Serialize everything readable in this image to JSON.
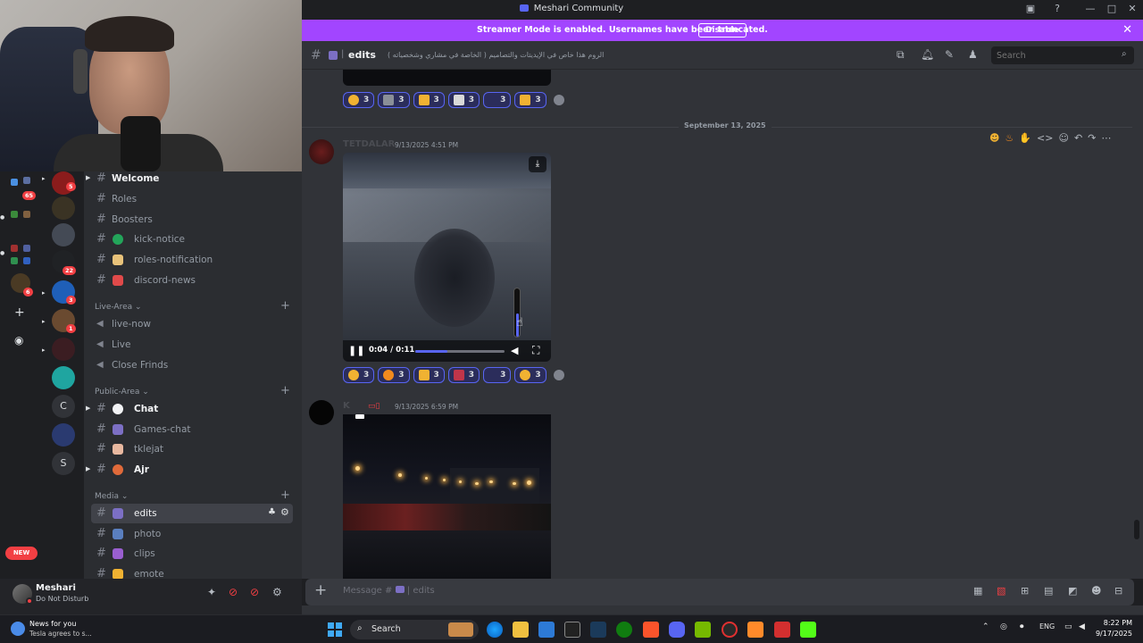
{
  "window": {
    "title": "Meshari Community"
  },
  "banner": {
    "message": "Streamer Mode is enabled. Usernames have been truncated.",
    "button": "Disable"
  },
  "rail": {
    "badges": [
      "5",
      "65",
      "22",
      "3",
      "6",
      "1"
    ],
    "letters": [
      "C",
      "S"
    ],
    "new_badge": "NEW"
  },
  "sidebar": {
    "channels_top": [
      {
        "label": "Welcome"
      },
      {
        "label": "Roles"
      },
      {
        "label": "Boosters"
      },
      {
        "label": "kick-notice"
      },
      {
        "label": "roles-notification"
      },
      {
        "label": "discord-news"
      }
    ],
    "live_area": {
      "category": "Live-Area",
      "channels": [
        "live-now",
        "Live",
        "Close Frinds"
      ]
    },
    "public_area": {
      "category": "Public-Area",
      "channels": [
        "Chat",
        "Games-chat",
        "tklejat",
        "Ajr"
      ]
    },
    "media": {
      "category": "Media",
      "channels": [
        "edits",
        "photo",
        "clips",
        "emote"
      ]
    }
  },
  "user": {
    "name": "Meshari",
    "status": "Do Not Disturb"
  },
  "channel": {
    "name": "edits",
    "topic": "الروم هذا خاص في الإيديتات والتصاميم ( الخاصة في مشاري وشخصياته )",
    "search_placeholder": "Search"
  },
  "chat": {
    "date_separator": "September 13, 2025",
    "first_reactions": [
      {
        "count": "3",
        "color": "#f0b232"
      },
      {
        "count": "3",
        "color": "#8a8f98"
      },
      {
        "count": "3",
        "color": "#f0b232"
      },
      {
        "count": "3",
        "color": "#d9d9d9"
      },
      {
        "count": "3",
        "color": "#2b2d5b"
      },
      {
        "count": "3",
        "color": "#f0b232"
      }
    ],
    "message1": {
      "author": "TETDALAR",
      "timestamp": "9/13/2025 4:51 PM",
      "video_time": "0:04 / 0:11",
      "progress": 0.36,
      "volume": 0.5,
      "reactions": [
        {
          "count": "3",
          "color": "#f0b232"
        },
        {
          "count": "3",
          "color": "#f28a1e"
        },
        {
          "count": "3",
          "color": "#f0b232"
        },
        {
          "count": "3",
          "color": "#c0354a"
        },
        {
          "count": "3",
          "color": "#2b2d5b"
        },
        {
          "count": "3",
          "color": "#f0b232"
        }
      ]
    },
    "message2": {
      "author": "K",
      "timestamp": "9/13/2025 6:59 PM"
    }
  },
  "composer": {
    "placeholder": "Message #",
    "channel": "edits"
  },
  "taskbar": {
    "news_title": "News for you",
    "news_sub": "Tesla agrees to s...",
    "search": "Search",
    "lang": "ENG",
    "time": "8:22 PM",
    "date": "9/17/2025"
  }
}
